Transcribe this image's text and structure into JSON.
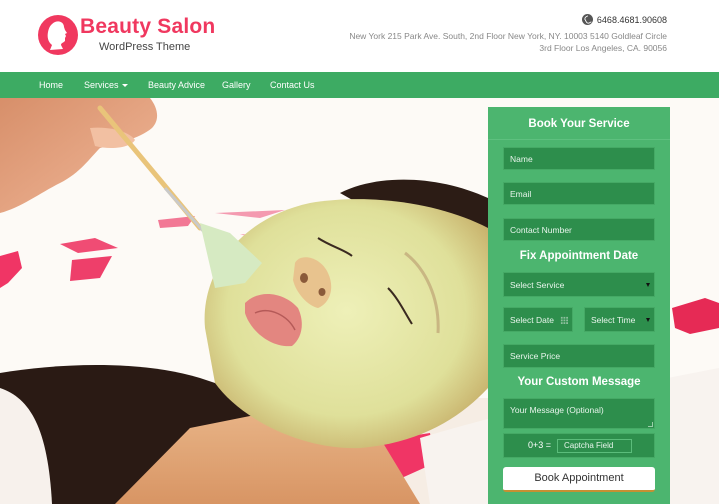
{
  "brand": {
    "title": "Beauty Salon",
    "subtitle": "WordPress Theme",
    "logo_icon": "woman-profile-icon",
    "accent_color": "#f0385f"
  },
  "contact": {
    "phone_icon": "phone-icon",
    "phone": "6468.4681.90608",
    "address_line1": "New York 215 Park Ave. South, 2nd Floor New York, NY. 10003 5140 Goldleaf Circle",
    "address_line2": "3rd Floor Los Angeles, CA. 90056"
  },
  "nav": {
    "color": "#3dab63",
    "items": [
      {
        "label": "Home"
      },
      {
        "label": "Services",
        "has_dropdown": true
      },
      {
        "label": "Beauty Advice"
      },
      {
        "label": "Gallery"
      },
      {
        "label": "Contact Us"
      }
    ]
  },
  "hero": {
    "image": "woman-facial-mask-photo"
  },
  "booking_form": {
    "title": "Book Your Service",
    "panel_color": "#4cb56f",
    "fields": {
      "name": {
        "placeholder": "Name",
        "value": ""
      },
      "email": {
        "placeholder": "Email",
        "value": ""
      },
      "contact": {
        "placeholder": "Contact Number",
        "value": ""
      }
    },
    "appointment_title": "Fix Appointment Date",
    "service_select": {
      "selected": "Select Service"
    },
    "date_field": {
      "placeholder": "Select Date",
      "icon": "calendar-icon"
    },
    "time_select": {
      "selected": "Select Time"
    },
    "price_field": {
      "placeholder": "Service Price",
      "value": ""
    },
    "message_title": "Your Custom Message",
    "message_field": {
      "placeholder": "Your Message (Optional)",
      "value": ""
    },
    "captcha": {
      "question": "0+3  =",
      "placeholder": "Captcha Field"
    },
    "submit_label": "Book Appointment"
  }
}
